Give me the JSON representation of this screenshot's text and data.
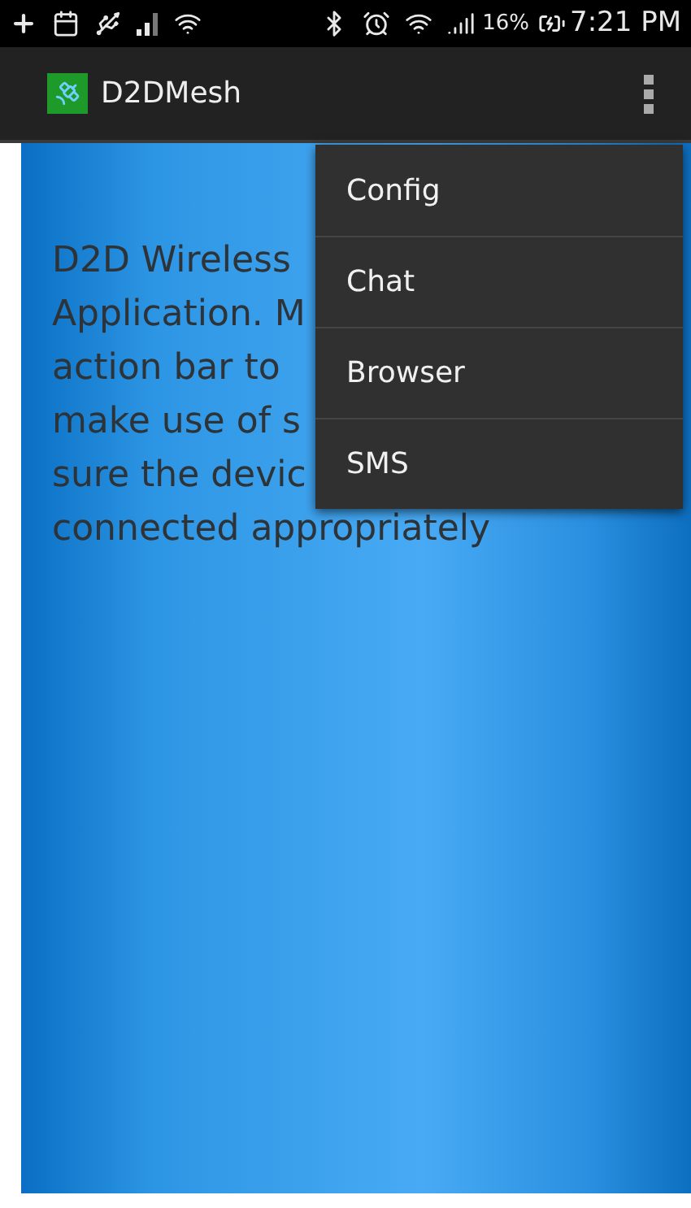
{
  "status_bar": {
    "battery_percent": "16%",
    "time": "7:21 PM"
  },
  "action_bar": {
    "title": "D2DMesh"
  },
  "content": {
    "lines": [
      "D2D Wireless",
      "Application. M",
      "action bar to",
      "make use of s",
      "sure the devic",
      "connected appropriately"
    ]
  },
  "overflow_menu": {
    "items": [
      {
        "label": "Config"
      },
      {
        "label": "Chat"
      },
      {
        "label": "Browser"
      },
      {
        "label": "SMS"
      }
    ]
  }
}
